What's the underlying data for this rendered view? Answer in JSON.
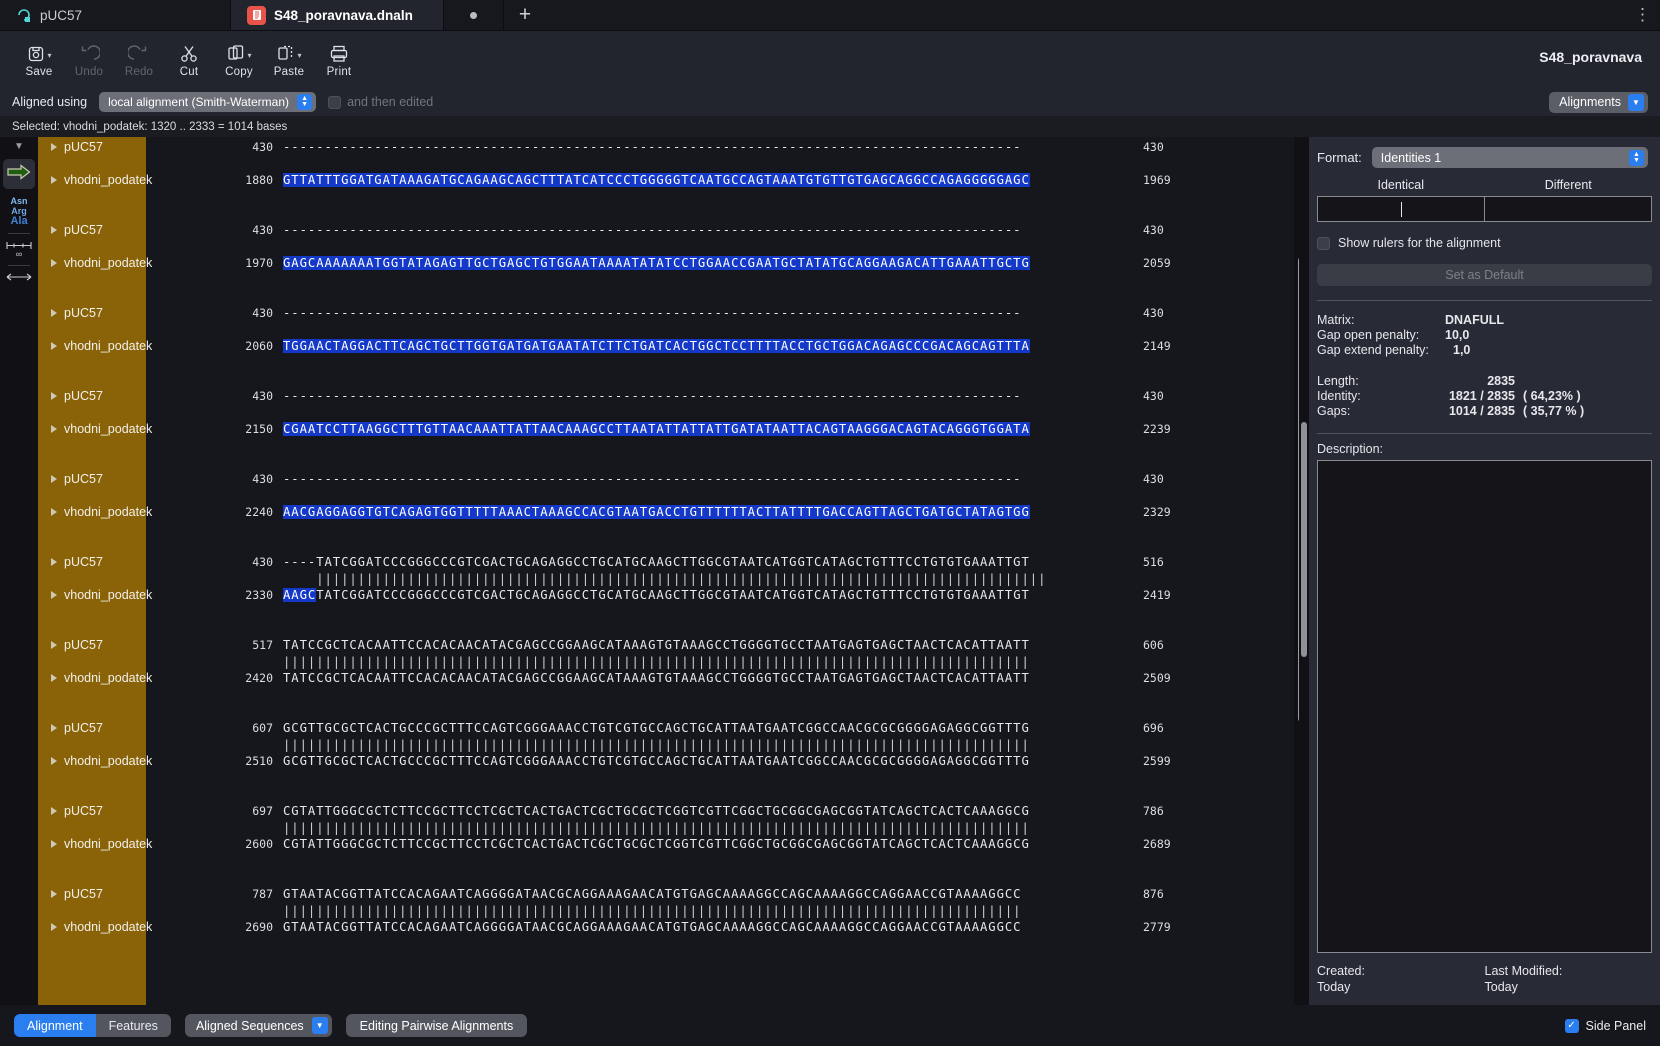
{
  "tabs": [
    {
      "label": "pUC57",
      "icon": "plasmid-icon",
      "active": false,
      "modified": false
    },
    {
      "label": "S48_poravnava.dnaln",
      "icon": "dna-alignment-icon",
      "active": true,
      "modified": true
    }
  ],
  "tabbar": {
    "new_tab": "+",
    "overflow_menu": "⋮"
  },
  "toolbar": {
    "buttons": [
      {
        "label": "Save",
        "icon": "save-icon",
        "enabled": true,
        "has_menu": true
      },
      {
        "label": "Undo",
        "icon": "undo-icon",
        "enabled": false,
        "has_menu": false
      },
      {
        "label": "Redo",
        "icon": "redo-icon",
        "enabled": false,
        "has_menu": false
      },
      {
        "label": "Cut",
        "icon": "scissors-icon",
        "enabled": true,
        "has_menu": false
      },
      {
        "label": "Copy",
        "icon": "copy-icon",
        "enabled": true,
        "has_menu": true
      },
      {
        "label": "Paste",
        "icon": "paste-icon",
        "enabled": true,
        "has_menu": true
      },
      {
        "label": "Print",
        "icon": "printer-icon",
        "enabled": true,
        "has_menu": false
      }
    ],
    "document_title": "S48_poravnava"
  },
  "alignbar": {
    "label": "Aligned using",
    "method": "local alignment  (Smith-Waterman)",
    "edited_label": "and then edited",
    "edited_checked": false,
    "alignments_button": "Alignments"
  },
  "selection": {
    "text": "Selected:  vhodni_podatek: 1320 .. 2333  =  1014 bases"
  },
  "rail": {
    "collapse_caret": "▼",
    "translate_icon": "arrow-right-icon",
    "codon_lines": [
      "Asn",
      "Arg",
      "Ala"
    ],
    "ruler_icon": "infinity-ruler-icon"
  },
  "alignment": {
    "seq_names": {
      "top": "pUC57",
      "bottom": "vhodni_podatek"
    },
    "blocks": [
      {
        "top_start": "430",
        "top_end": "430",
        "top_seq": [
          {
            "t": "-----------------------------------------------------------------------------------------",
            "hl": false
          }
        ],
        "match": "",
        "bot_start": "1880",
        "bot_end": "1969",
        "bot_seq": [
          {
            "t": "GTTATTTGGATGATAAAGATGCAGAAGCAGCTTTATCATCCCTGGGGGTCAATGCCAGTAAATGTGTTGTGAGCAGGCCAGAGGGGGAGC",
            "hl": true
          }
        ]
      },
      {
        "top_start": "430",
        "top_end": "430",
        "top_seq": [
          {
            "t": "-----------------------------------------------------------------------------------------",
            "hl": false
          }
        ],
        "match": "",
        "bot_start": "1970",
        "bot_end": "2059",
        "bot_seq": [
          {
            "t": "GAGCAAAAAAATGGTATAGAGTTGCTGAGCTGTGGAATAAAATATATCCTGGAACCGAATGCTATATGCAGGAAGACATTGAAATTGCTG",
            "hl": true
          }
        ]
      },
      {
        "top_start": "430",
        "top_end": "430",
        "top_seq": [
          {
            "t": "-----------------------------------------------------------------------------------------",
            "hl": false
          }
        ],
        "match": "",
        "bot_start": "2060",
        "bot_end": "2149",
        "bot_seq": [
          {
            "t": "TGGAACTAGGACTTCAGCTGCTTGGTGATGATGAATATCTTCTGATCACTGGCTCCTTTTACCTGCTGGACAGAGCCCGACAGCAGTTTA",
            "hl": true
          }
        ]
      },
      {
        "top_start": "430",
        "top_end": "430",
        "top_seq": [
          {
            "t": "-----------------------------------------------------------------------------------------",
            "hl": false
          }
        ],
        "match": "",
        "bot_start": "2150",
        "bot_end": "2239",
        "bot_seq": [
          {
            "t": "CGAATCCTTAAGGCTTTGTTAACAAATTATTAACAAAGCCTTAATATTATTATTGATATAATTACAGTAAGGGACAGTACAGGGTGGATA",
            "hl": true
          }
        ]
      },
      {
        "top_start": "430",
        "top_end": "430",
        "top_seq": [
          {
            "t": "-----------------------------------------------------------------------------------------",
            "hl": false
          }
        ],
        "match": "",
        "bot_start": "2240",
        "bot_end": "2329",
        "bot_seq": [
          {
            "t": "AACGAGGAGGTGTCAGAGTGGTTTTTAAACTAAAGCCACGTAATGACCTGTTTTTTACTTATTTTGACCAGTTAGCTGATGCTATAGTGG",
            "hl": true
          }
        ]
      },
      {
        "top_start": "430",
        "top_end": "516",
        "top_seq": [
          {
            "t": "----TATCGGATCCCGGGCCCGTCGACTGCAGAGGCCTGCATGCAAGCTTGGCGTAATCATGGTCATAGCTGTTTCCTGTGTGAAATTGT",
            "hl": false
          }
        ],
        "match": "    ||||||||||||||||||||||||||||||||||||||||||||||||||||||||||||||||||||||||||||||||||||||||",
        "bot_start": "2330",
        "bot_end": "2419",
        "bot_seq": [
          {
            "t": "AAGC",
            "hl": true
          },
          {
            "t": "TATCGGATCCCGGGCCCGTCGACTGCAGAGGCCTGCATGCAAGCTTGGCGTAATCATGGTCATAGCTGTTTCCTGTGTGAAATTGT",
            "hl": false
          }
        ]
      },
      {
        "top_start": "517",
        "top_end": "606",
        "top_seq": [
          {
            "t": "TATCCGCTCACAATTCCACACAACATACGAGCCGGAAGCATAAAGTGTAAAGCCTGGGGTGCCTAATGAGTGAGCTAACTCACATTAATT",
            "hl": false
          }
        ],
        "match": "||||||||||||||||||||||||||||||||||||||||||||||||||||||||||||||||||||||||||||||||||||||||||",
        "bot_start": "2420",
        "bot_end": "2509",
        "bot_seq": [
          {
            "t": "TATCCGCTCACAATTCCACACAACATACGAGCCGGAAGCATAAAGTGTAAAGCCTGGGGTGCCTAATGAGTGAGCTAACTCACATTAATT",
            "hl": false
          }
        ]
      },
      {
        "top_start": "607",
        "top_end": "696",
        "top_seq": [
          {
            "t": "GCGTTGCGCTCACTGCCCGCTTTCCAGTCGGGAAACCTGTCGTGCCAGCTGCATTAATGAATCGGCCAACGCGCGGGGAGAGGCGGTTTG",
            "hl": false
          }
        ],
        "match": "||||||||||||||||||||||||||||||||||||||||||||||||||||||||||||||||||||||||||||||||||||||||||",
        "bot_start": "2510",
        "bot_end": "2599",
        "bot_seq": [
          {
            "t": "GCGTTGCGCTCACTGCCCGCTTTCCAGTCGGGAAACCTGTCGTGCCAGCTGCATTAATGAATCGGCCAACGCGCGGGGAGAGGCGGTTTG",
            "hl": false
          }
        ]
      },
      {
        "top_start": "697",
        "top_end": "786",
        "top_seq": [
          {
            "t": "CGTATTGGGCGCTCTTCCGCTTCCTCGCTCACTGACTCGCTGCGCTCGGTCGTTCGGCTGCGGCGAGCGGTATCAGCTCACTCAAAGGCG",
            "hl": false
          }
        ],
        "match": "||||||||||||||||||||||||||||||||||||||||||||||||||||||||||||||||||||||||||||||||||||||||||",
        "bot_start": "2600",
        "bot_end": "2689",
        "bot_seq": [
          {
            "t": "CGTATTGGGCGCTCTTCCGCTTCCTCGCTCACTGACTCGCTGCGCTCGGTCGTTCGGCTGCGGCGAGCGGTATCAGCTCACTCAAAGGCG",
            "hl": false
          }
        ]
      },
      {
        "top_start": "787",
        "top_end": "876",
        "top_seq": [
          {
            "t": "GTAATACGGTTATCCACAGAATCAGGGGATAACGCAGGAAAGAACATGTGAGCAAAAGGCCAGCAAAAGGCCAGGAACCGTAAAAGGCC",
            "hl": false
          }
        ],
        "match": "|||||||||||||||||||||||||||||||||||||||||||||||||||||||||||||||||||||||||||||||||||||||||",
        "bot_start": "2690",
        "bot_end": "2779",
        "bot_seq": [
          {
            "t": "GTAATACGGTTATCCACAGAATCAGGGGATAACGCAGGAAAGAACATGTGAGCAAAAGGCCAGCAAAAGGCCAGGAACCGTAAAAGGCC",
            "hl": false
          }
        ]
      }
    ]
  },
  "side_panel": {
    "format_label": "Format:",
    "format_value": "Identities 1",
    "col_identical": "Identical",
    "col_different": "Different",
    "identical_value": "",
    "different_value": "",
    "show_rulers_label": "Show rulers for the alignment",
    "show_rulers_checked": false,
    "set_default_label": "Set as Default",
    "params": [
      {
        "key": "Matrix:",
        "value": "DNAFULL"
      },
      {
        "key": "Gap open penalty:",
        "value": "10,0"
      },
      {
        "key": "Gap extend penalty:",
        "value": "1,0"
      }
    ],
    "stats": [
      {
        "key": "Length:",
        "value": "2835",
        "extra": ""
      },
      {
        "key": "Identity:",
        "value": "1821 / 2835",
        "extra": "( 64,23% )"
      },
      {
        "key": "Gaps:",
        "value": "1014 / 2835",
        "extra": "( 35,77 % )"
      }
    ],
    "description_label": "Description:",
    "description_value": "",
    "created_label": "Created:",
    "created_value": "Today",
    "modified_label": "Last Modified:",
    "modified_value": "Today"
  },
  "footer": {
    "seg_alignment": "Alignment",
    "seg_features": "Features",
    "aligned_sequences": "Aligned Sequences",
    "editing_button": "Editing Pairwise Alignments",
    "side_panel_label": "Side Panel",
    "side_panel_checked": true
  },
  "colors": {
    "accent": "#2a7ef0",
    "highlight": "#1439c8",
    "names_bg": "#8a6308",
    "tab_red": "#e8534a"
  }
}
